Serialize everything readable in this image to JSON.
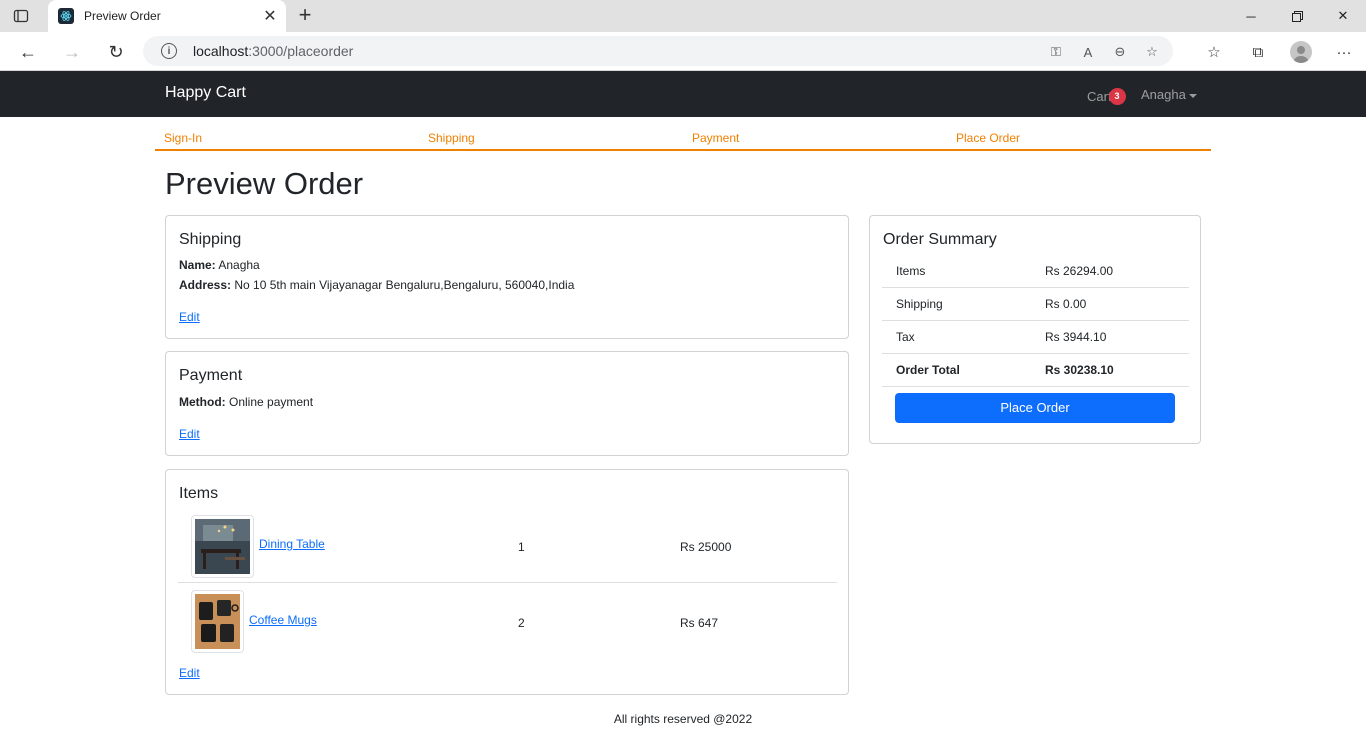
{
  "browser": {
    "tab_title": "Preview Order",
    "url_host": "localhost",
    "url_rest": ":3000/placeorder"
  },
  "navbar": {
    "brand": "Happy Cart",
    "cart_label": "Cart",
    "cart_count": "3",
    "user_name": "Anagha"
  },
  "steps": [
    "Sign-In",
    "Shipping",
    "Payment",
    "Place Order"
  ],
  "page_title": "Preview Order",
  "shipping": {
    "heading": "Shipping",
    "name_label": "Name:",
    "name_value": "Anagha",
    "address_label": "Address:",
    "address_value": "No 10 5th main Vijayanagar Bengaluru,Bengaluru, 560040,India",
    "edit": "Edit"
  },
  "payment": {
    "heading": "Payment",
    "method_label": "Method:",
    "method_value": "Online payment",
    "edit": "Edit"
  },
  "items": {
    "heading": "Items",
    "rows": [
      {
        "name": "Dining Table",
        "qty": "1",
        "price": "Rs 25000"
      },
      {
        "name": "Coffee Mugs",
        "qty": "2",
        "price": "Rs 647"
      }
    ],
    "edit": "Edit"
  },
  "summary": {
    "heading": "Order Summary",
    "rows": [
      {
        "label": "Items",
        "value": "Rs 26294.00"
      },
      {
        "label": "Shipping",
        "value": "Rs 0.00"
      },
      {
        "label": "Tax",
        "value": "Rs 3944.10"
      },
      {
        "label": "Order Total",
        "value": "Rs 30238.10"
      }
    ],
    "button": "Place Order"
  },
  "footer": "All rights reserved @2022",
  "colors": {
    "accent": "#f08000",
    "primary": "#0d6efd",
    "navbar": "#212529",
    "badge": "#dc3545"
  }
}
